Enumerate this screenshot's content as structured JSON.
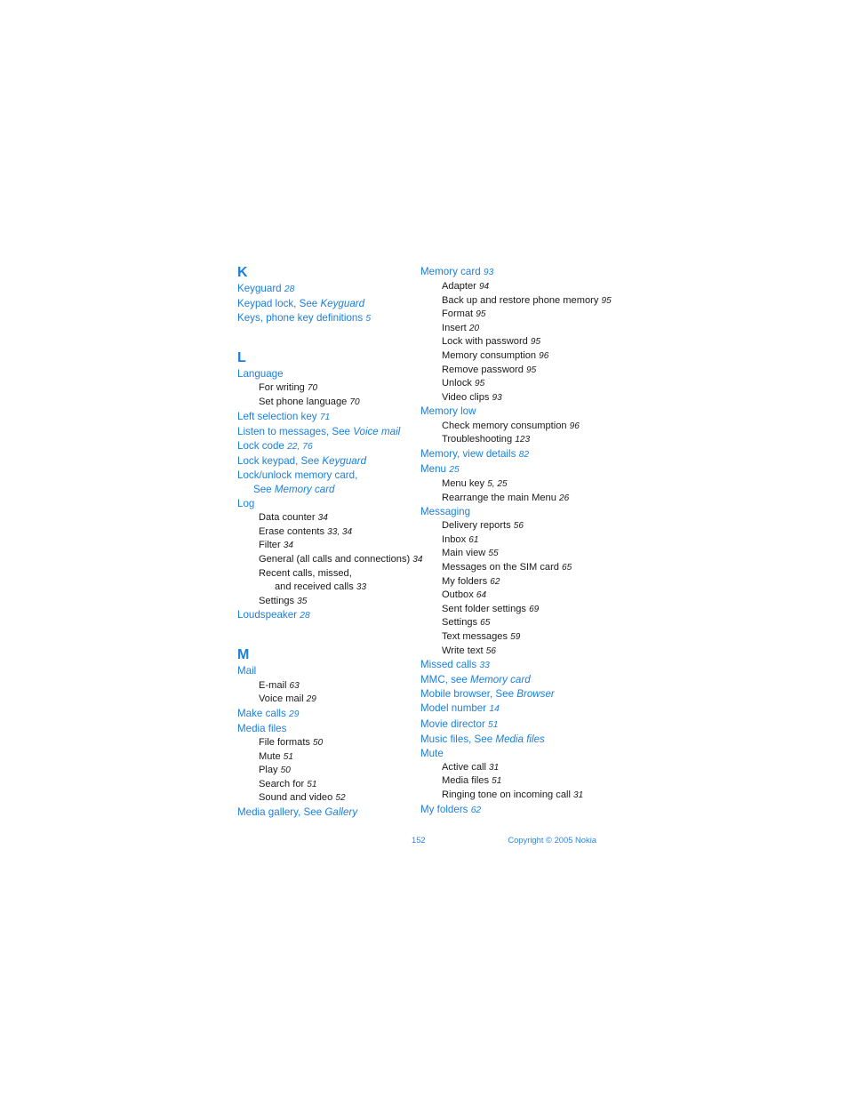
{
  "document": {
    "type": "index",
    "colors": {
      "link_blue": "#1a7fdd",
      "footer_blue": "#2e86e0",
      "body_text": "#1a1a1a",
      "background": "#ffffff"
    }
  },
  "footer": {
    "page_number": "152",
    "copyright": "Copyright © 2005 Nokia"
  },
  "columns": [
    {
      "name": "left-column",
      "blocks": [
        {
          "letter": "K",
          "spaced": false,
          "lines": [
            {
              "level": "entry",
              "text": "Keyguard ",
              "page": "28"
            },
            {
              "level": "entry",
              "text": "Keypad lock, See ",
              "xref": "Keyguard"
            },
            {
              "level": "entry",
              "text": "Keys, phone key definitions ",
              "page": "5"
            }
          ]
        },
        {
          "letter": "L",
          "spaced": true,
          "lines": [
            {
              "level": "entry",
              "text": "Language"
            },
            {
              "level": "sub",
              "text": "For writing ",
              "page": "70"
            },
            {
              "level": "sub",
              "text": "Set phone language ",
              "page": "70"
            },
            {
              "level": "entry",
              "text": "Left selection key ",
              "page": "71"
            },
            {
              "level": "entry",
              "text": "Listen to messages, See ",
              "xref": "Voice mail"
            },
            {
              "level": "entry",
              "text": "Lock code ",
              "page": "22, 76"
            },
            {
              "level": "entry",
              "text": "Lock keypad, See ",
              "xref": "Keyguard"
            },
            {
              "level": "entry",
              "text": "Lock/unlock memory card,"
            },
            {
              "level": "entry-cont",
              "text": "See ",
              "xref": "Memory card"
            },
            {
              "level": "entry",
              "text": "Log"
            },
            {
              "level": "sub",
              "text": "Data counter ",
              "page": "34"
            },
            {
              "level": "sub",
              "text": "Erase contents ",
              "page": "33, 34"
            },
            {
              "level": "sub",
              "text": "Filter ",
              "page": "34"
            },
            {
              "level": "sub",
              "text": "General (all calls and connections) ",
              "page": "34"
            },
            {
              "level": "sub",
              "text": "Recent calls, missed,"
            },
            {
              "level": "sub-cont",
              "text": "and received calls ",
              "page": "33"
            },
            {
              "level": "sub",
              "text": "Settings ",
              "page": "35"
            },
            {
              "level": "entry",
              "text": "Loudspeaker ",
              "page": "28"
            }
          ]
        },
        {
          "letter": "M",
          "spaced": true,
          "lines": [
            {
              "level": "entry",
              "text": "Mail"
            },
            {
              "level": "sub",
              "text": "E-mail ",
              "page": "63"
            },
            {
              "level": "sub",
              "text": "Voice mail ",
              "page": "29"
            },
            {
              "level": "entry",
              "text": "Make calls ",
              "page": "29"
            },
            {
              "level": "entry",
              "text": "Media files"
            },
            {
              "level": "sub",
              "text": "File formats ",
              "page": "50"
            },
            {
              "level": "sub",
              "text": "Mute ",
              "page": "51"
            },
            {
              "level": "sub",
              "text": "Play ",
              "page": "50"
            },
            {
              "level": "sub",
              "text": "Search for ",
              "page": "51"
            },
            {
              "level": "sub",
              "text": "Sound and video ",
              "page": "52"
            },
            {
              "level": "entry",
              "text": "Media gallery, See ",
              "xref": "Gallery"
            }
          ]
        }
      ]
    },
    {
      "name": "right-column",
      "blocks": [
        {
          "letter": null,
          "spaced": false,
          "lines": [
            {
              "level": "entry",
              "text": "Memory card ",
              "page": "93"
            },
            {
              "level": "sub",
              "text": "Adapter ",
              "page": "94"
            },
            {
              "level": "sub",
              "text": "Back up and restore phone memory ",
              "page": "95"
            },
            {
              "level": "sub",
              "text": "Format ",
              "page": "95"
            },
            {
              "level": "sub",
              "text": "Insert ",
              "page": "20"
            },
            {
              "level": "sub",
              "text": "Lock with password ",
              "page": "95"
            },
            {
              "level": "sub",
              "text": "Memory consumption ",
              "page": "96"
            },
            {
              "level": "sub",
              "text": "Remove password ",
              "page": "95"
            },
            {
              "level": "sub",
              "text": "Unlock ",
              "page": "95"
            },
            {
              "level": "sub",
              "text": "Video clips ",
              "page": "93"
            },
            {
              "level": "entry",
              "text": "Memory low"
            },
            {
              "level": "sub",
              "text": "Check memory consumption ",
              "page": "96"
            },
            {
              "level": "sub",
              "text": "Troubleshooting ",
              "page": "123"
            },
            {
              "level": "entry",
              "text": "Memory, view details ",
              "page": "82"
            },
            {
              "level": "entry",
              "text": "Menu ",
              "page": "25"
            },
            {
              "level": "sub",
              "text": "Menu key ",
              "page": "5, 25"
            },
            {
              "level": "sub",
              "text": "Rearrange the main Menu ",
              "page": "26"
            },
            {
              "level": "entry",
              "text": "Messaging"
            },
            {
              "level": "sub",
              "text": "Delivery reports ",
              "page": "56"
            },
            {
              "level": "sub",
              "text": "Inbox ",
              "page": "61"
            },
            {
              "level": "sub",
              "text": "Main view ",
              "page": "55"
            },
            {
              "level": "sub",
              "text": "Messages on the SIM card ",
              "page": "65"
            },
            {
              "level": "sub",
              "text": "My folders ",
              "page": "62"
            },
            {
              "level": "sub",
              "text": "Outbox ",
              "page": "64"
            },
            {
              "level": "sub",
              "text": "Sent folder settings ",
              "page": "69"
            },
            {
              "level": "sub",
              "text": "Settings ",
              "page": "65"
            },
            {
              "level": "sub",
              "text": "Text messages ",
              "page": "59"
            },
            {
              "level": "sub",
              "text": "Write text ",
              "page": "56"
            },
            {
              "level": "entry",
              "text": "Missed calls ",
              "page": "33"
            },
            {
              "level": "entry",
              "text": "MMC, see ",
              "xref": "Memory card"
            },
            {
              "level": "entry",
              "text": "Mobile browser, See ",
              "xref": "Browser"
            },
            {
              "level": "entry",
              "text": "Model number ",
              "page": "14"
            },
            {
              "level": "entry",
              "text": "Movie director ",
              "page": "51"
            },
            {
              "level": "entry",
              "text": "Music files, See ",
              "xref": "Media files"
            },
            {
              "level": "entry",
              "text": "Mute"
            },
            {
              "level": "sub",
              "text": "Active call ",
              "page": "31"
            },
            {
              "level": "sub",
              "text": "Media files ",
              "page": "51"
            },
            {
              "level": "sub",
              "text": "Ringing tone on incoming call ",
              "page": "31"
            },
            {
              "level": "entry",
              "text": "My folders ",
              "page": "62"
            }
          ]
        }
      ]
    }
  ]
}
